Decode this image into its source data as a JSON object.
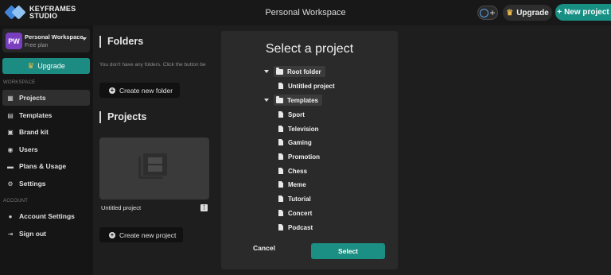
{
  "app": {
    "logo_line1": "KEYFRAMES",
    "logo_line2": "STUDIO"
  },
  "header": {
    "workspace_title": "Personal Workspace",
    "upgrade_label": "Upgrade",
    "new_project_label": "New project"
  },
  "sidebar": {
    "workspace": {
      "initials": "PW",
      "name": "Personal Workspace",
      "plan": "Free plan"
    },
    "upgrade_label": "Upgrade",
    "workspace_section": "WORKSPACE",
    "workspace_items": [
      {
        "label": "Projects",
        "icon": "projects-icon"
      },
      {
        "label": "Templates",
        "icon": "templates-icon"
      },
      {
        "label": "Brand kit",
        "icon": "brand-kit-icon"
      },
      {
        "label": "Users",
        "icon": "users-icon"
      },
      {
        "label": "Plans & Usage",
        "icon": "plans-icon"
      },
      {
        "label": "Settings",
        "icon": "settings-icon"
      }
    ],
    "account_section": "ACCOUNT",
    "account_items": [
      {
        "label": "Account Settings",
        "icon": "account-icon"
      },
      {
        "label": "Sign out",
        "icon": "sign-out-icon"
      }
    ]
  },
  "main": {
    "folders_title": "Folders",
    "folders_hint": "You don't have any folders. Click the button be",
    "create_folder_label": "Create new folder",
    "projects_title": "Projects",
    "project_card_label": "Untitled project",
    "project_menu_glyph": "⋮",
    "create_project_label": "Create new project"
  },
  "modal": {
    "title": "Select a project",
    "tree": {
      "root_folder": "Root folder",
      "root_items": [
        "Untitled project"
      ],
      "templates_folder": "Templates",
      "template_items": [
        "Sport",
        "Television",
        "Gaming",
        "Promotion",
        "Chess",
        "Meme",
        "Tutorial",
        "Concert",
        "Podcast"
      ]
    },
    "cancel_label": "Cancel",
    "select_label": "Select"
  },
  "colors": {
    "accent": "#1b8f83",
    "avatar": "#7a3fbf",
    "background": "#1e1e1e",
    "modal": "#2a2a2a"
  }
}
